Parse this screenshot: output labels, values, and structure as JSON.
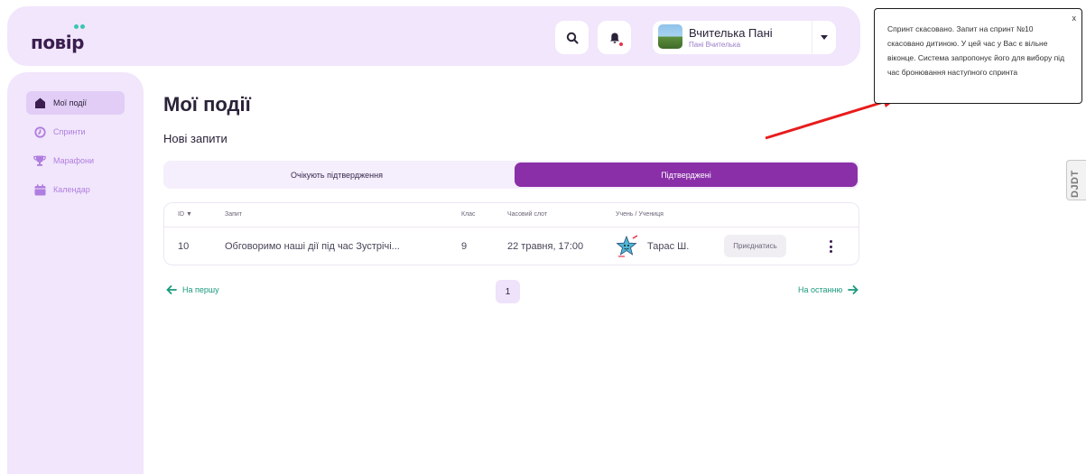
{
  "header": {
    "logo": "повір",
    "user": {
      "name": "Вчителька Пані",
      "role": "Пані Вчителька"
    }
  },
  "sidebar": {
    "items": [
      {
        "label": "Мої події",
        "icon": "home-icon",
        "active": true
      },
      {
        "label": "Спринти",
        "icon": "sprint-icon",
        "active": false
      },
      {
        "label": "Марафони",
        "icon": "trophy-icon",
        "active": false
      },
      {
        "label": "Календар",
        "icon": "calendar-icon",
        "active": false
      }
    ]
  },
  "main": {
    "title": "Мої події",
    "subtitle": "Нові запити",
    "tabs": [
      {
        "label": "Очікують підтвердження",
        "active": false
      },
      {
        "label": "Підтверджені",
        "active": true
      }
    ],
    "table": {
      "headers": {
        "id": "ID ▼",
        "request": "Запит",
        "grade": "Клас",
        "slot": "Часовий слот",
        "student": "Учень / Учениця"
      },
      "rows": [
        {
          "id": "10",
          "request": "Обговоримо наші дії під час Зустрічі...",
          "grade": "9",
          "slot": "22 травня, 17:00",
          "student": "Тарас Ш.",
          "action": "Приєднатись"
        }
      ]
    },
    "pagination": {
      "first": "На першу",
      "last": "На останню",
      "current": "1"
    }
  },
  "toast": {
    "message": "Спринт скасовано. Запит на спринт №10 скасовано дитиною. У цей час у Вас є вільне віконце. Система запропонує його для вибору під час бронювання наступного спринта",
    "close": "x"
  },
  "side_tab": {
    "label": "DJDT"
  },
  "colors": {
    "accent": "#8a2fa8",
    "panel": "#f1e6fb",
    "link": "#1a9a7e",
    "arrow": "#e81c1c"
  }
}
